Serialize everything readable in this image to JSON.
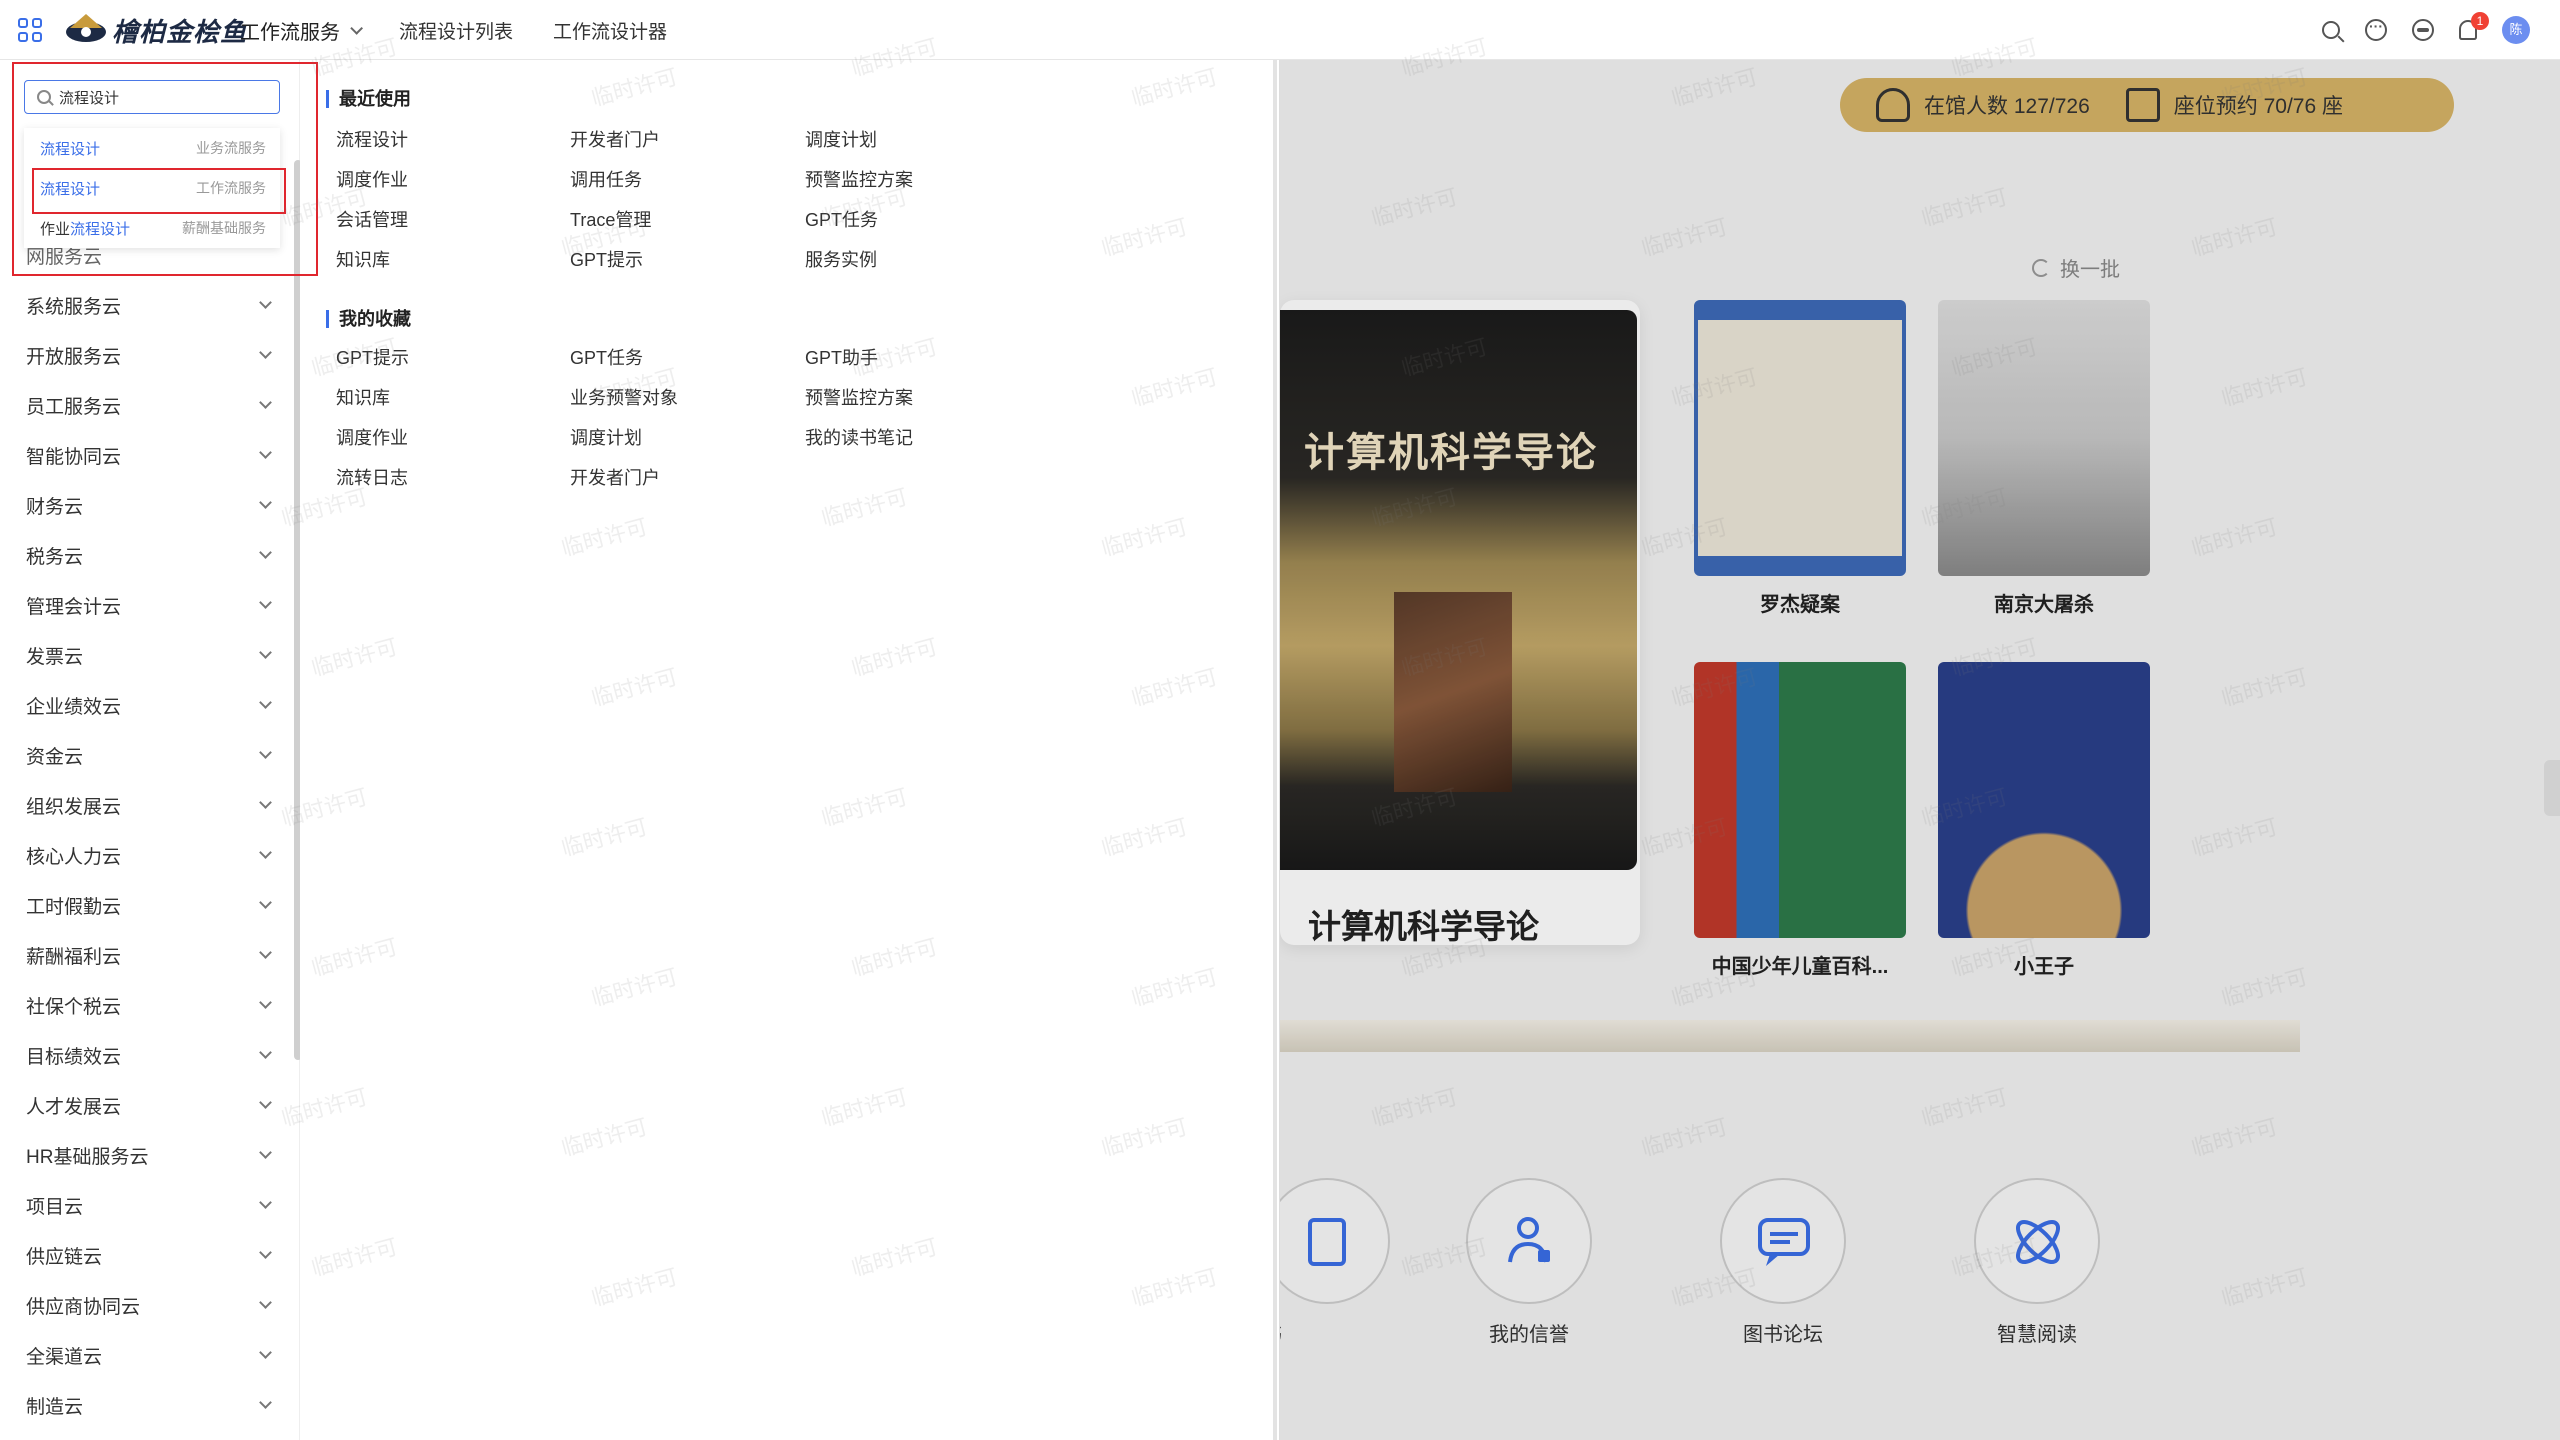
{
  "header": {
    "logo_text": "檜柏金桧鱼",
    "nav": [
      {
        "label": "工作流服务"
      },
      {
        "label": "流程设计列表"
      },
      {
        "label": "工作流设计器"
      }
    ],
    "notification_count": "1",
    "avatar_text": "陈"
  },
  "search": {
    "value": "流程设计",
    "suggestions": [
      {
        "prefix": "",
        "match": "流程设计",
        "category": "业务流服务"
      },
      {
        "prefix": "",
        "match": "流程设计",
        "category": "工作流服务"
      },
      {
        "prefix": "作业",
        "match": "流程设计",
        "category": "薪酬基础服务"
      }
    ]
  },
  "sidebar": {
    "partial_top_label": "网服务云",
    "items": [
      {
        "label": "系统服务云"
      },
      {
        "label": "开放服务云"
      },
      {
        "label": "员工服务云"
      },
      {
        "label": "智能协同云"
      },
      {
        "label": "财务云"
      },
      {
        "label": "税务云"
      },
      {
        "label": "管理会计云"
      },
      {
        "label": "发票云"
      },
      {
        "label": "企业绩效云"
      },
      {
        "label": "资金云"
      },
      {
        "label": "组织发展云"
      },
      {
        "label": "核心人力云"
      },
      {
        "label": "工时假勤云"
      },
      {
        "label": "薪酬福利云"
      },
      {
        "label": "社保个税云"
      },
      {
        "label": "目标绩效云"
      },
      {
        "label": "人才发展云"
      },
      {
        "label": "HR基础服务云"
      },
      {
        "label": "项目云"
      },
      {
        "label": "供应链云"
      },
      {
        "label": "供应商协同云"
      },
      {
        "label": "全渠道云"
      },
      {
        "label": "制造云"
      }
    ]
  },
  "menu": {
    "recent_title": "最近使用",
    "recent": [
      [
        "流程设计",
        "开发者门户",
        "调度计划"
      ],
      [
        "调度作业",
        "调用任务",
        "预警监控方案"
      ],
      [
        "会话管理",
        "Trace管理",
        "GPT任务"
      ],
      [
        "知识库",
        "GPT提示",
        "服务实例"
      ]
    ],
    "favorites_title": "我的收藏",
    "favorites": [
      [
        "GPT提示",
        "GPT任务",
        "GPT助手"
      ],
      [
        "知识库",
        "业务预警对象",
        "预警监控方案"
      ],
      [
        "调度作业",
        "调度计划",
        "我的读书笔记"
      ],
      [
        "流转日志",
        "开发者门户",
        ""
      ]
    ]
  },
  "home": {
    "visitors_label": "在馆人数 127/726",
    "seats_label": "座位预约 70/76 座",
    "refresh_label": "换一批",
    "featured_book": {
      "title": "计算机科学导论",
      "cover_title": "计算机科学导论"
    },
    "books": [
      {
        "title": "罗杰疑案"
      },
      {
        "title": "南京大屠杀"
      },
      {
        "title": "中国少年儿童百科..."
      },
      {
        "title": "小王子"
      }
    ],
    "features": [
      {
        "label": "图书"
      },
      {
        "label": "我的信誉"
      },
      {
        "label": "图书论坛"
      },
      {
        "label": "智慧阅读"
      }
    ]
  },
  "watermark_text": "临时许可",
  "colors": {
    "accent": "#3a6ee8",
    "highlight_border": "#e0262e",
    "stats_bar": "#d6b366"
  }
}
